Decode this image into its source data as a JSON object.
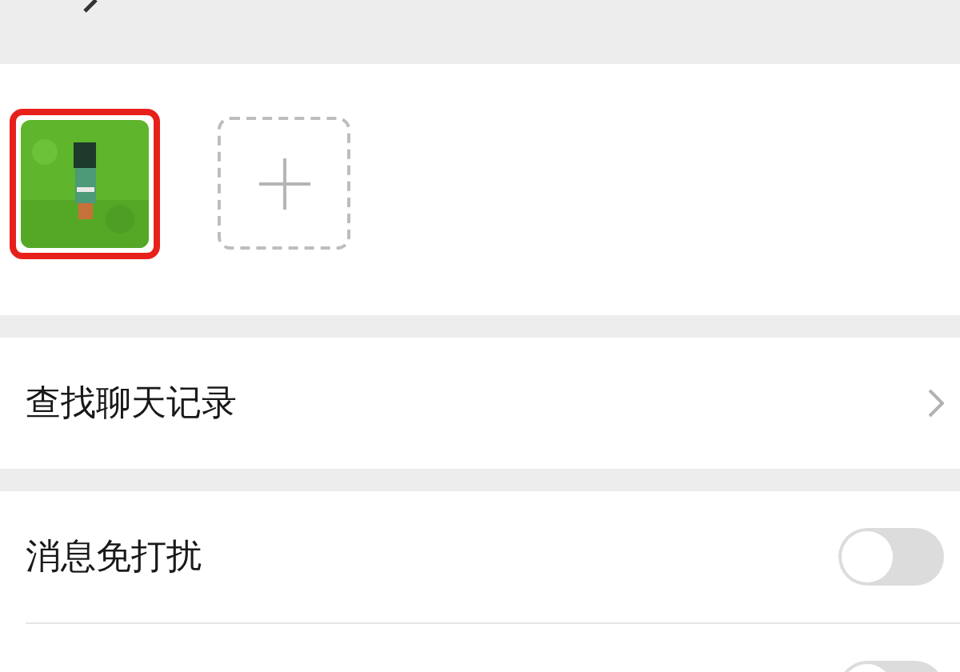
{
  "header": {
    "back": true
  },
  "members": [
    {
      "kind": "picture",
      "highlighted": true
    },
    {
      "kind": "add"
    }
  ],
  "sections": [
    {
      "rows": [
        {
          "kind": "link",
          "label": "查找聊天记录"
        }
      ]
    },
    {
      "rows": [
        {
          "kind": "toggle",
          "label": "消息免打扰",
          "on": false
        },
        {
          "kind": "toggle",
          "on": false
        }
      ]
    }
  ]
}
